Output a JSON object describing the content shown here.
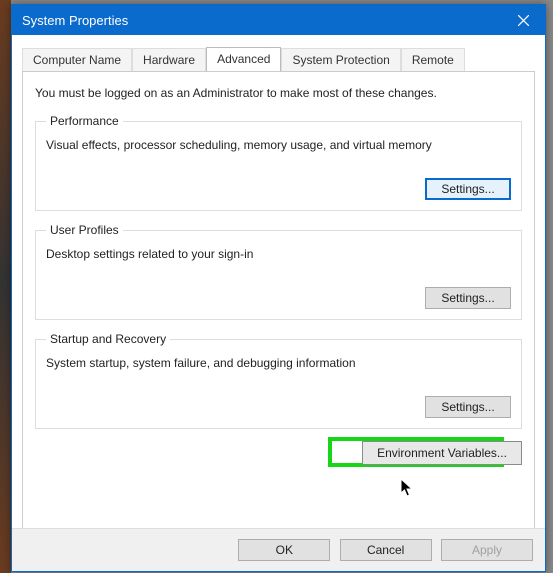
{
  "window": {
    "title": "System Properties"
  },
  "tabs": {
    "computer_name": "Computer Name",
    "hardware": "Hardware",
    "advanced": "Advanced",
    "system_protection": "System Protection",
    "remote": "Remote"
  },
  "advanced": {
    "intro": "You must be logged on as an Administrator to make most of these changes.",
    "performance": {
      "legend": "Performance",
      "desc": "Visual effects, processor scheduling, memory usage, and virtual memory",
      "settings": "Settings..."
    },
    "user_profiles": {
      "legend": "User Profiles",
      "desc": "Desktop settings related to your sign-in",
      "settings": "Settings..."
    },
    "startup": {
      "legend": "Startup and Recovery",
      "desc": "System startup, system failure, and debugging information",
      "settings": "Settings..."
    },
    "env_button": "Environment Variables..."
  },
  "footer": {
    "ok": "OK",
    "cancel": "Cancel",
    "apply": "Apply"
  }
}
